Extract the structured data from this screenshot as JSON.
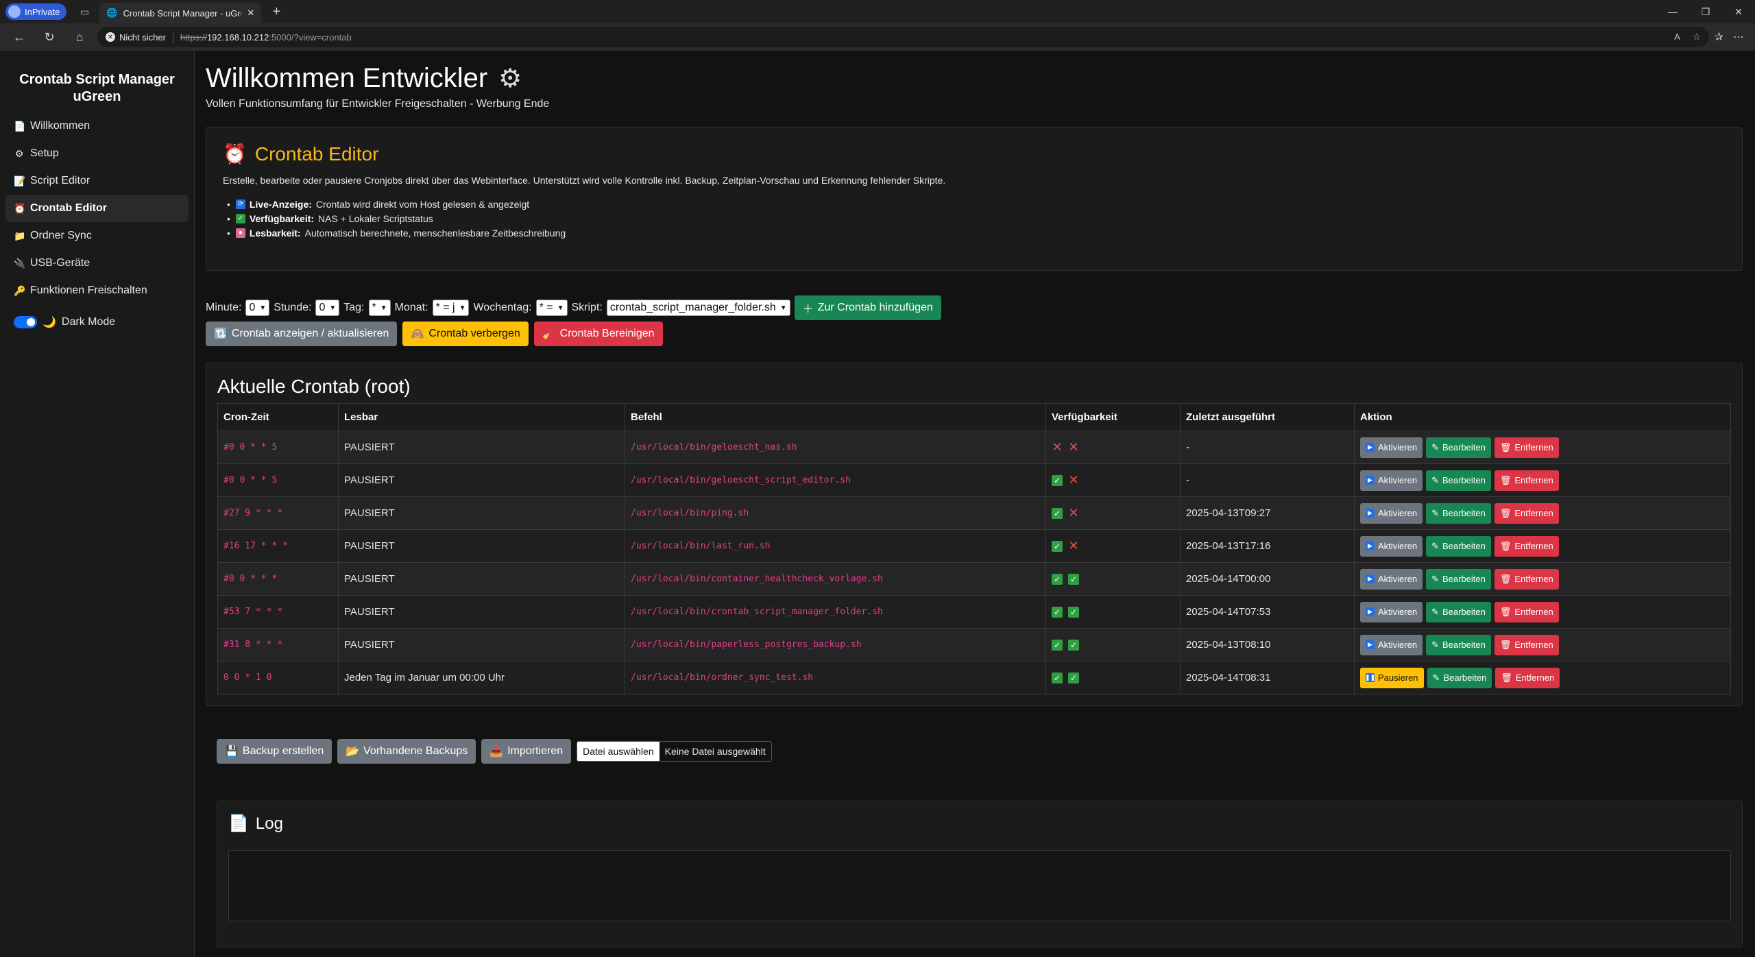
{
  "browser": {
    "inprivate_label": "InPrivate",
    "tab_title": "Crontab Script Manager - uGreen",
    "security_label": "Nicht sicher",
    "url_scheme": "https://",
    "url_host": "192.168.10.212",
    "url_rest": ":5000/?view=crontab"
  },
  "sidebar": {
    "title": "Crontab Script Manager uGreen",
    "items": [
      {
        "icon": "📄",
        "label": "Willkommen"
      },
      {
        "icon": "⚙",
        "label": "Setup"
      },
      {
        "icon": "📝",
        "label": "Script Editor"
      },
      {
        "icon": "⏰",
        "label": "Crontab Editor"
      },
      {
        "icon": "📁",
        "label": "Ordner Sync"
      },
      {
        "icon": "🔌",
        "label": "USB-Geräte"
      },
      {
        "icon": "🔑",
        "label": "Funktionen Freischalten"
      }
    ],
    "dark_mode_label": "Dark Mode"
  },
  "header": {
    "title": "Willkommen Entwickler",
    "subtitle": "Vollen Funktionsumfang für Entwickler Freigeschalten - Werbung Ende"
  },
  "editor": {
    "title": "Crontab Editor",
    "description": "Erstelle, bearbeite oder pausiere Cronjobs direkt über das Webinterface. Unterstützt wird volle Kontrolle inkl. Backup, Zeitplan-Vorschau und Erkennung fehlender Skripte.",
    "features": [
      {
        "bold": "Live-Anzeige:",
        "text": "Crontab wird direkt vom Host gelesen & angezeigt",
        "color": "#1f6feb"
      },
      {
        "bold": "Verfügbarkeit:",
        "text": "NAS + Lokaler Scriptstatus",
        "color": "#2ea043"
      },
      {
        "bold": "Lesbarkeit:",
        "text": "Automatisch berechnete, menschenlesbare Zeitbeschreibung",
        "color": "#d86f8f"
      }
    ]
  },
  "form": {
    "minute_label": "Minute:",
    "minute_value": "0",
    "hour_label": "Stunde:",
    "hour_value": "0",
    "day_label": "Tag:",
    "day_value": "*",
    "month_label": "Monat:",
    "month_value": "* = j",
    "weekday_label": "Wochentag:",
    "weekday_value": "* = ",
    "script_label": "Skript:",
    "script_value": "crontab_script_manager_folder.sh",
    "add_button": "Zur Crontab hinzufügen",
    "show_button": "Crontab anzeigen / aktualisieren",
    "hide_button": "Crontab verbergen",
    "clean_button": "Crontab Bereinigen"
  },
  "crontab": {
    "title": "Aktuelle Crontab (root)",
    "columns": [
      "Cron-Zeit",
      "Lesbar",
      "Befehl",
      "Verfügbarkeit",
      "Zuletzt ausgeführt",
      "Aktion"
    ],
    "rows": [
      {
        "cron": "#0 0 * * 5",
        "readable": "PAUSIERT",
        "command": "/usr/local/bin/geloescht_nas.sh",
        "nas": false,
        "local": false,
        "last": "-",
        "toggle": "Aktivieren"
      },
      {
        "cron": "#0 0 * * 5",
        "readable": "PAUSIERT",
        "command": "/usr/local/bin/geloescht_script_editor.sh",
        "nas": true,
        "local": false,
        "last": "-",
        "toggle": "Aktivieren"
      },
      {
        "cron": "#27 9 * * *",
        "readable": "PAUSIERT",
        "command": "/usr/local/bin/ping.sh",
        "nas": true,
        "local": false,
        "last": "2025-04-13T09:27",
        "toggle": "Aktivieren"
      },
      {
        "cron": "#16 17 * * *",
        "readable": "PAUSIERT",
        "command": "/usr/local/bin/last_run.sh",
        "nas": true,
        "local": false,
        "last": "2025-04-13T17:16",
        "toggle": "Aktivieren"
      },
      {
        "cron": "#0 0 * * *",
        "readable": "PAUSIERT",
        "command": "/usr/local/bin/container_healthcheck_vorlage.sh",
        "nas": true,
        "local": true,
        "last": "2025-04-14T00:00",
        "toggle": "Aktivieren"
      },
      {
        "cron": "#53 7 * * *",
        "readable": "PAUSIERT",
        "command": "/usr/local/bin/crontab_script_manager_folder.sh",
        "nas": true,
        "local": true,
        "last": "2025-04-14T07:53",
        "toggle": "Aktivieren"
      },
      {
        "cron": "#31 8 * * *",
        "readable": "PAUSIERT",
        "command": "/usr/local/bin/paperless_postgres_backup.sh",
        "nas": true,
        "local": true,
        "last": "2025-04-13T08:10",
        "toggle": "Aktivieren"
      },
      {
        "cron": "0 0 * 1 0",
        "readable": "Jeden Tag im Januar um 00:00 Uhr",
        "command": "/usr/local/bin/ordner_sync_test.sh",
        "nas": true,
        "local": true,
        "last": "2025-04-14T08:31",
        "toggle": "Pausieren"
      }
    ],
    "edit_label": "Bearbeiten",
    "remove_label": "Entfernen"
  },
  "backup": {
    "create_button": "Backup erstellen",
    "existing_button": "Vorhandene Backups",
    "import_button": "Importieren",
    "file_choose": "Datei auswählen",
    "file_none": "Keine Datei ausgewählt"
  },
  "log": {
    "title": "Log"
  }
}
